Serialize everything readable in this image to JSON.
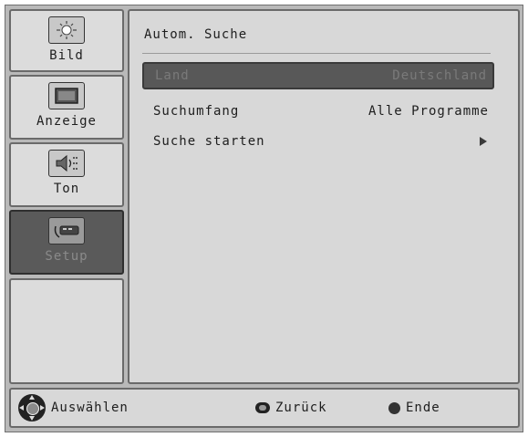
{
  "sidebar": {
    "tabs": [
      {
        "label": "Bild",
        "icon": "sun-icon",
        "active": false
      },
      {
        "label": "Anzeige",
        "icon": "display-icon",
        "active": false
      },
      {
        "label": "Ton",
        "icon": "speaker-icon",
        "active": false
      },
      {
        "label": "Setup",
        "icon": "remote-setup-icon",
        "active": true
      }
    ]
  },
  "main": {
    "title": "Autom. Suche",
    "rows": [
      {
        "label": "Land",
        "value": "Deutschland",
        "selected": true
      },
      {
        "label": "Suchumfang",
        "value": "Alle Programme",
        "selected": false
      },
      {
        "label": "Suche starten",
        "value": "",
        "icon": "play-arrow-icon",
        "selected": false
      }
    ]
  },
  "footer": {
    "select_label": "Auswählen",
    "back_label": "Zurück",
    "exit_label": "Ende"
  },
  "colors": {
    "panel": "#d8d8d8",
    "frame": "#b9b9b9",
    "selected": "#585858"
  }
}
